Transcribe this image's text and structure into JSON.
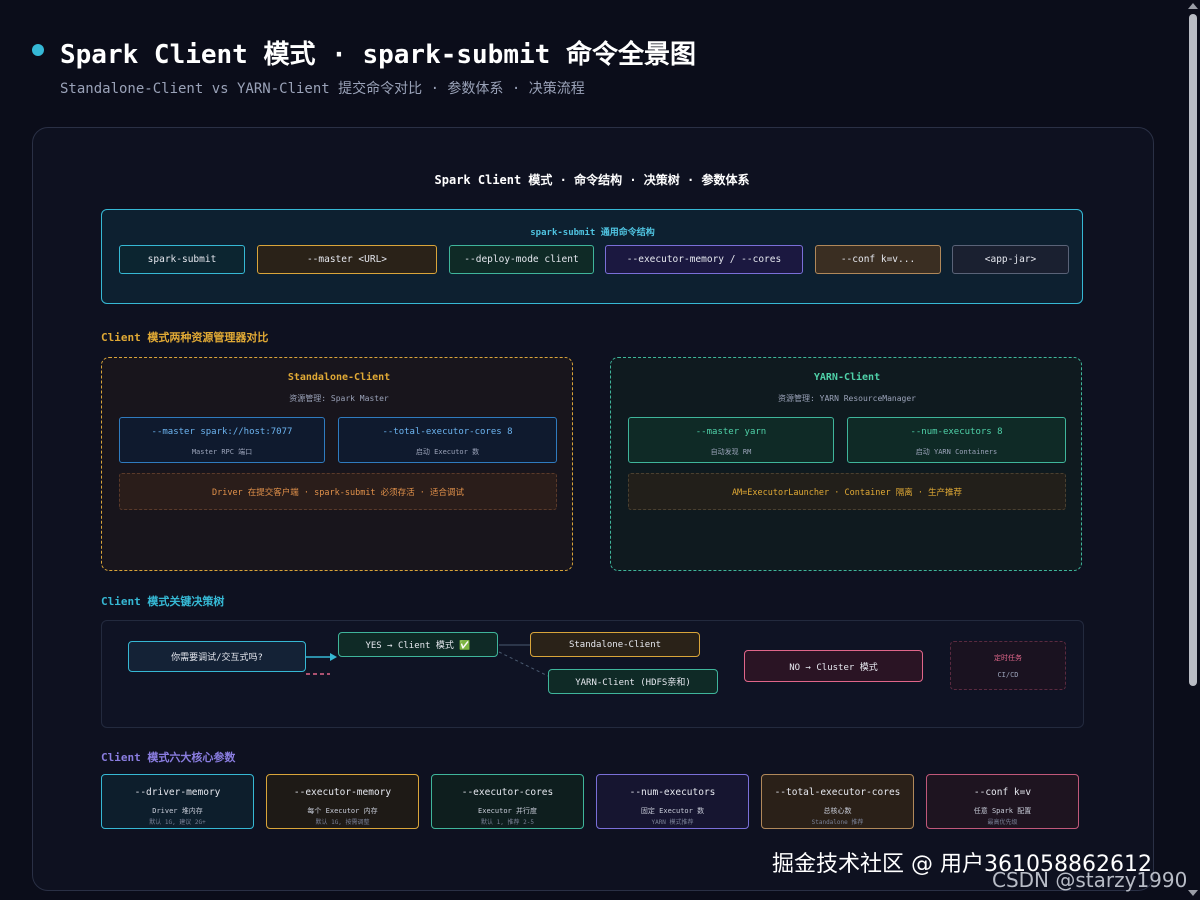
{
  "header": {
    "title": "Spark Client 模式 · spark-submit 命令全景图",
    "subtitle": "Standalone-Client vs YARN-Client 提交命令对比 · 参数体系 · 决策流程"
  },
  "diagram": {
    "title": "Spark Client 模式 · 命令结构 · 决策树 · 参数体系",
    "command_structure": {
      "title": "spark-submit 通用命令结构",
      "parts": [
        "spark-submit",
        "--master <URL>",
        "--deploy-mode client",
        "--executor-memory / --cores",
        "--conf k=v...",
        "<app-jar>"
      ]
    },
    "comparison": {
      "label": "Client 模式两种资源管理器对比",
      "standalone": {
        "title": "Standalone-Client",
        "subtitle": "资源管理: Spark Master",
        "param1": {
          "main": "--master spark://host:7077",
          "sub": "Master RPC 端口"
        },
        "param2": {
          "main": "--total-executor-cores 8",
          "sub": "启动 Executor 数"
        },
        "note": "Driver 在提交客户端 · spark-submit 必须存活 · 适合调试"
      },
      "yarn": {
        "title": "YARN-Client",
        "subtitle": "资源管理: YARN ResourceManager",
        "param1": {
          "main": "--master yarn",
          "sub": "自动发现 RM"
        },
        "param2": {
          "main": "--num-executors 8",
          "sub": "启动 YARN Containers"
        },
        "note": "AM=ExecutorLauncher · Container 隔离 · 生产推荐"
      }
    },
    "decision_tree": {
      "label": "Client 模式关键决策树",
      "question": "你需要调试/交互式吗?",
      "yes": "YES → Client 模式 ✅",
      "standalone": "Standalone-Client",
      "yarn": "YARN-Client (HDFS亲和)",
      "no": "NO → Cluster 模式",
      "scheduled_title": "定时任务",
      "scheduled_sub": "CI/CD"
    },
    "core_params": {
      "label": "Client 模式六大核心参数",
      "items": [
        {
          "name": "--driver-memory",
          "desc": "Driver 堆内存",
          "note": "默认 1G, 建议 2G+"
        },
        {
          "name": "--executor-memory",
          "desc": "每个 Executor 内存",
          "note": "默认 1G, 按需调整"
        },
        {
          "name": "--executor-cores",
          "desc": "Executor 并行度",
          "note": "默认 1, 推荐 2-5"
        },
        {
          "name": "--num-executors",
          "desc": "固定 Executor 数",
          "note": "YARN 模式推荐"
        },
        {
          "name": "--total-executor-cores",
          "desc": "总核心数",
          "note": "Standalone 推荐"
        },
        {
          "name": "--conf k=v",
          "desc": "任意 Spark 配置",
          "note": "最高优先级"
        }
      ]
    }
  },
  "watermark": {
    "line1": "掘金技术社区 @ 用户361058862612",
    "line2": "CSDN @starzy1990"
  },
  "colors": {
    "background": "#0b0d1a",
    "cyan": "#36b8d4",
    "amber": "#e0a935",
    "teal": "#3fb59b",
    "purple": "#8a7de0",
    "pink": "#e0668a"
  }
}
